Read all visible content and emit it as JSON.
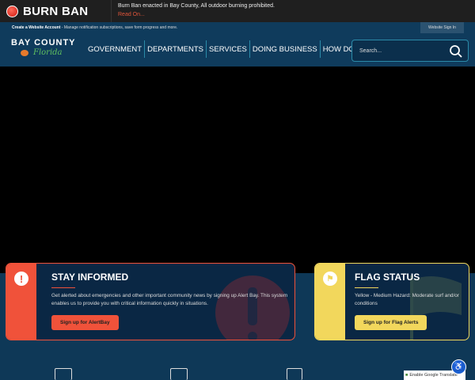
{
  "alert": {
    "title": "BURN BAN",
    "message": "Burn Ban enacted in Bay County, All outdoor burning prohibited.",
    "link": "Read On..."
  },
  "header": {
    "account_link": "Create a Website Account",
    "account_text": " - Manage notification subscriptions, save form progress and more.",
    "sign_in": "Website Sign In",
    "logo_top": "BAY COUNTY",
    "logo_bottom": "Florida",
    "nav": [
      "GOVERNMENT",
      "DEPARTMENTS",
      "SERVICES",
      "DOING BUSINESS",
      "HOW DO I..."
    ],
    "search_placeholder": "Search..."
  },
  "cards": {
    "stay": {
      "title": "STAY INFORMED",
      "text": "Get alerted about emergencies and other important community news by signing up Alert Bay. This system enables us to provide you with critical information quickly in situations.",
      "button": "Sign up for AlertBay",
      "color": "#f0523a"
    },
    "flag": {
      "title": "FLAG STATUS",
      "text": "Yellow - Medium Hazard: Moderate surf and/or conditions",
      "button": "Sign up for Flag Alerts",
      "color": "#f2d75c"
    }
  },
  "translate": "Enable Google Translate"
}
